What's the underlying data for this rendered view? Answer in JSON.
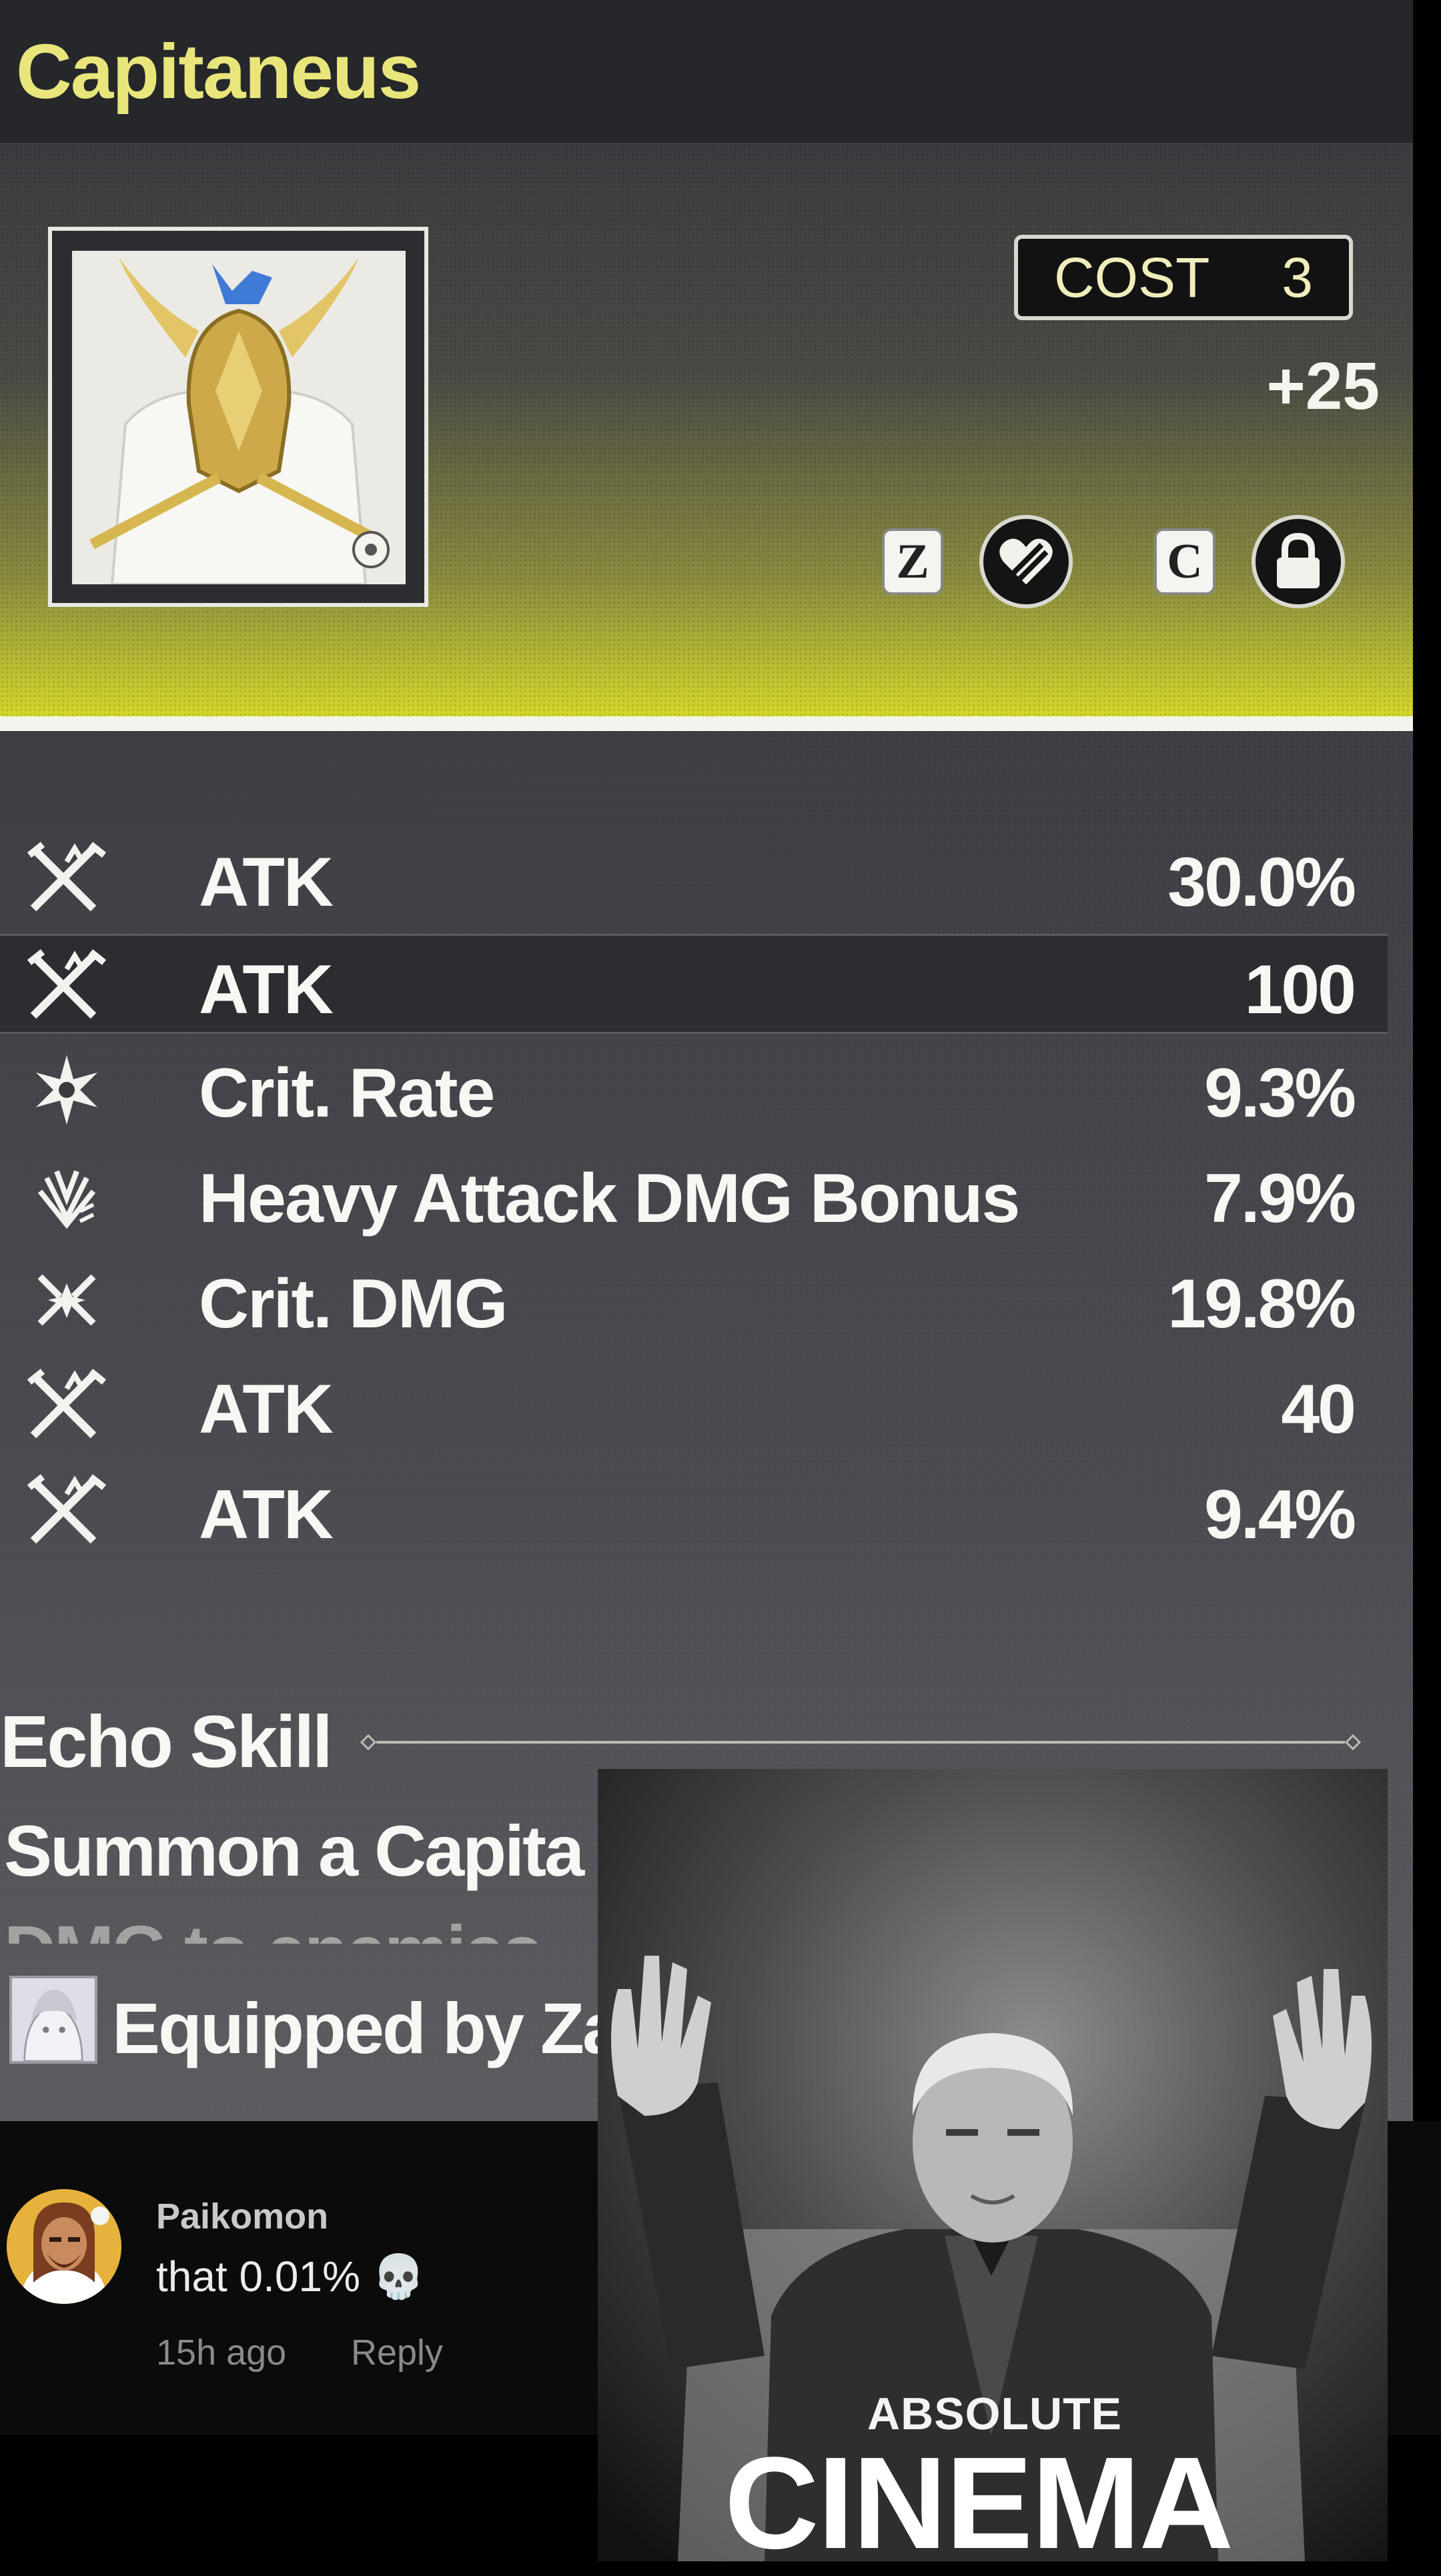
{
  "echo": {
    "name": "Capitaneus",
    "cost_label": "COST",
    "cost_value": "3",
    "level": "+25"
  },
  "hotkeys": {
    "discard_key": "Z",
    "lock_key": "C"
  },
  "stats": [
    {
      "icon": "atk-icon",
      "name": "ATK",
      "value": "30.0%"
    },
    {
      "icon": "atk-icon",
      "name": "ATK",
      "value": "100"
    },
    {
      "icon": "crit-rate-icon",
      "name": "Crit. Rate",
      "value": "9.3%"
    },
    {
      "icon": "heavy-attack-icon",
      "name": "Heavy Attack DMG Bonus",
      "value": "7.9%"
    },
    {
      "icon": "crit-dmg-icon",
      "name": "Crit. DMG",
      "value": "19.8%"
    },
    {
      "icon": "atk-icon",
      "name": "ATK",
      "value": "40"
    },
    {
      "icon": "atk-icon",
      "name": "ATK",
      "value": "9.4%"
    }
  ],
  "echo_skill": {
    "title": "Echo Skill",
    "description": "Summon a Capita",
    "description_cut": "DMG to enemies"
  },
  "equipped": {
    "text": "Equipped by Za"
  },
  "comment": {
    "user": "Paikomon",
    "text": "that 0.01% 💀",
    "time": "15h ago",
    "reply": "Reply"
  },
  "meme": {
    "subtitle": "ABSOLUTE",
    "title": "CINEMA"
  },
  "colors": {
    "title_yellow": "#e8e67a",
    "header_lime": "#d7dc2a",
    "text_white": "#f7f7f4"
  }
}
